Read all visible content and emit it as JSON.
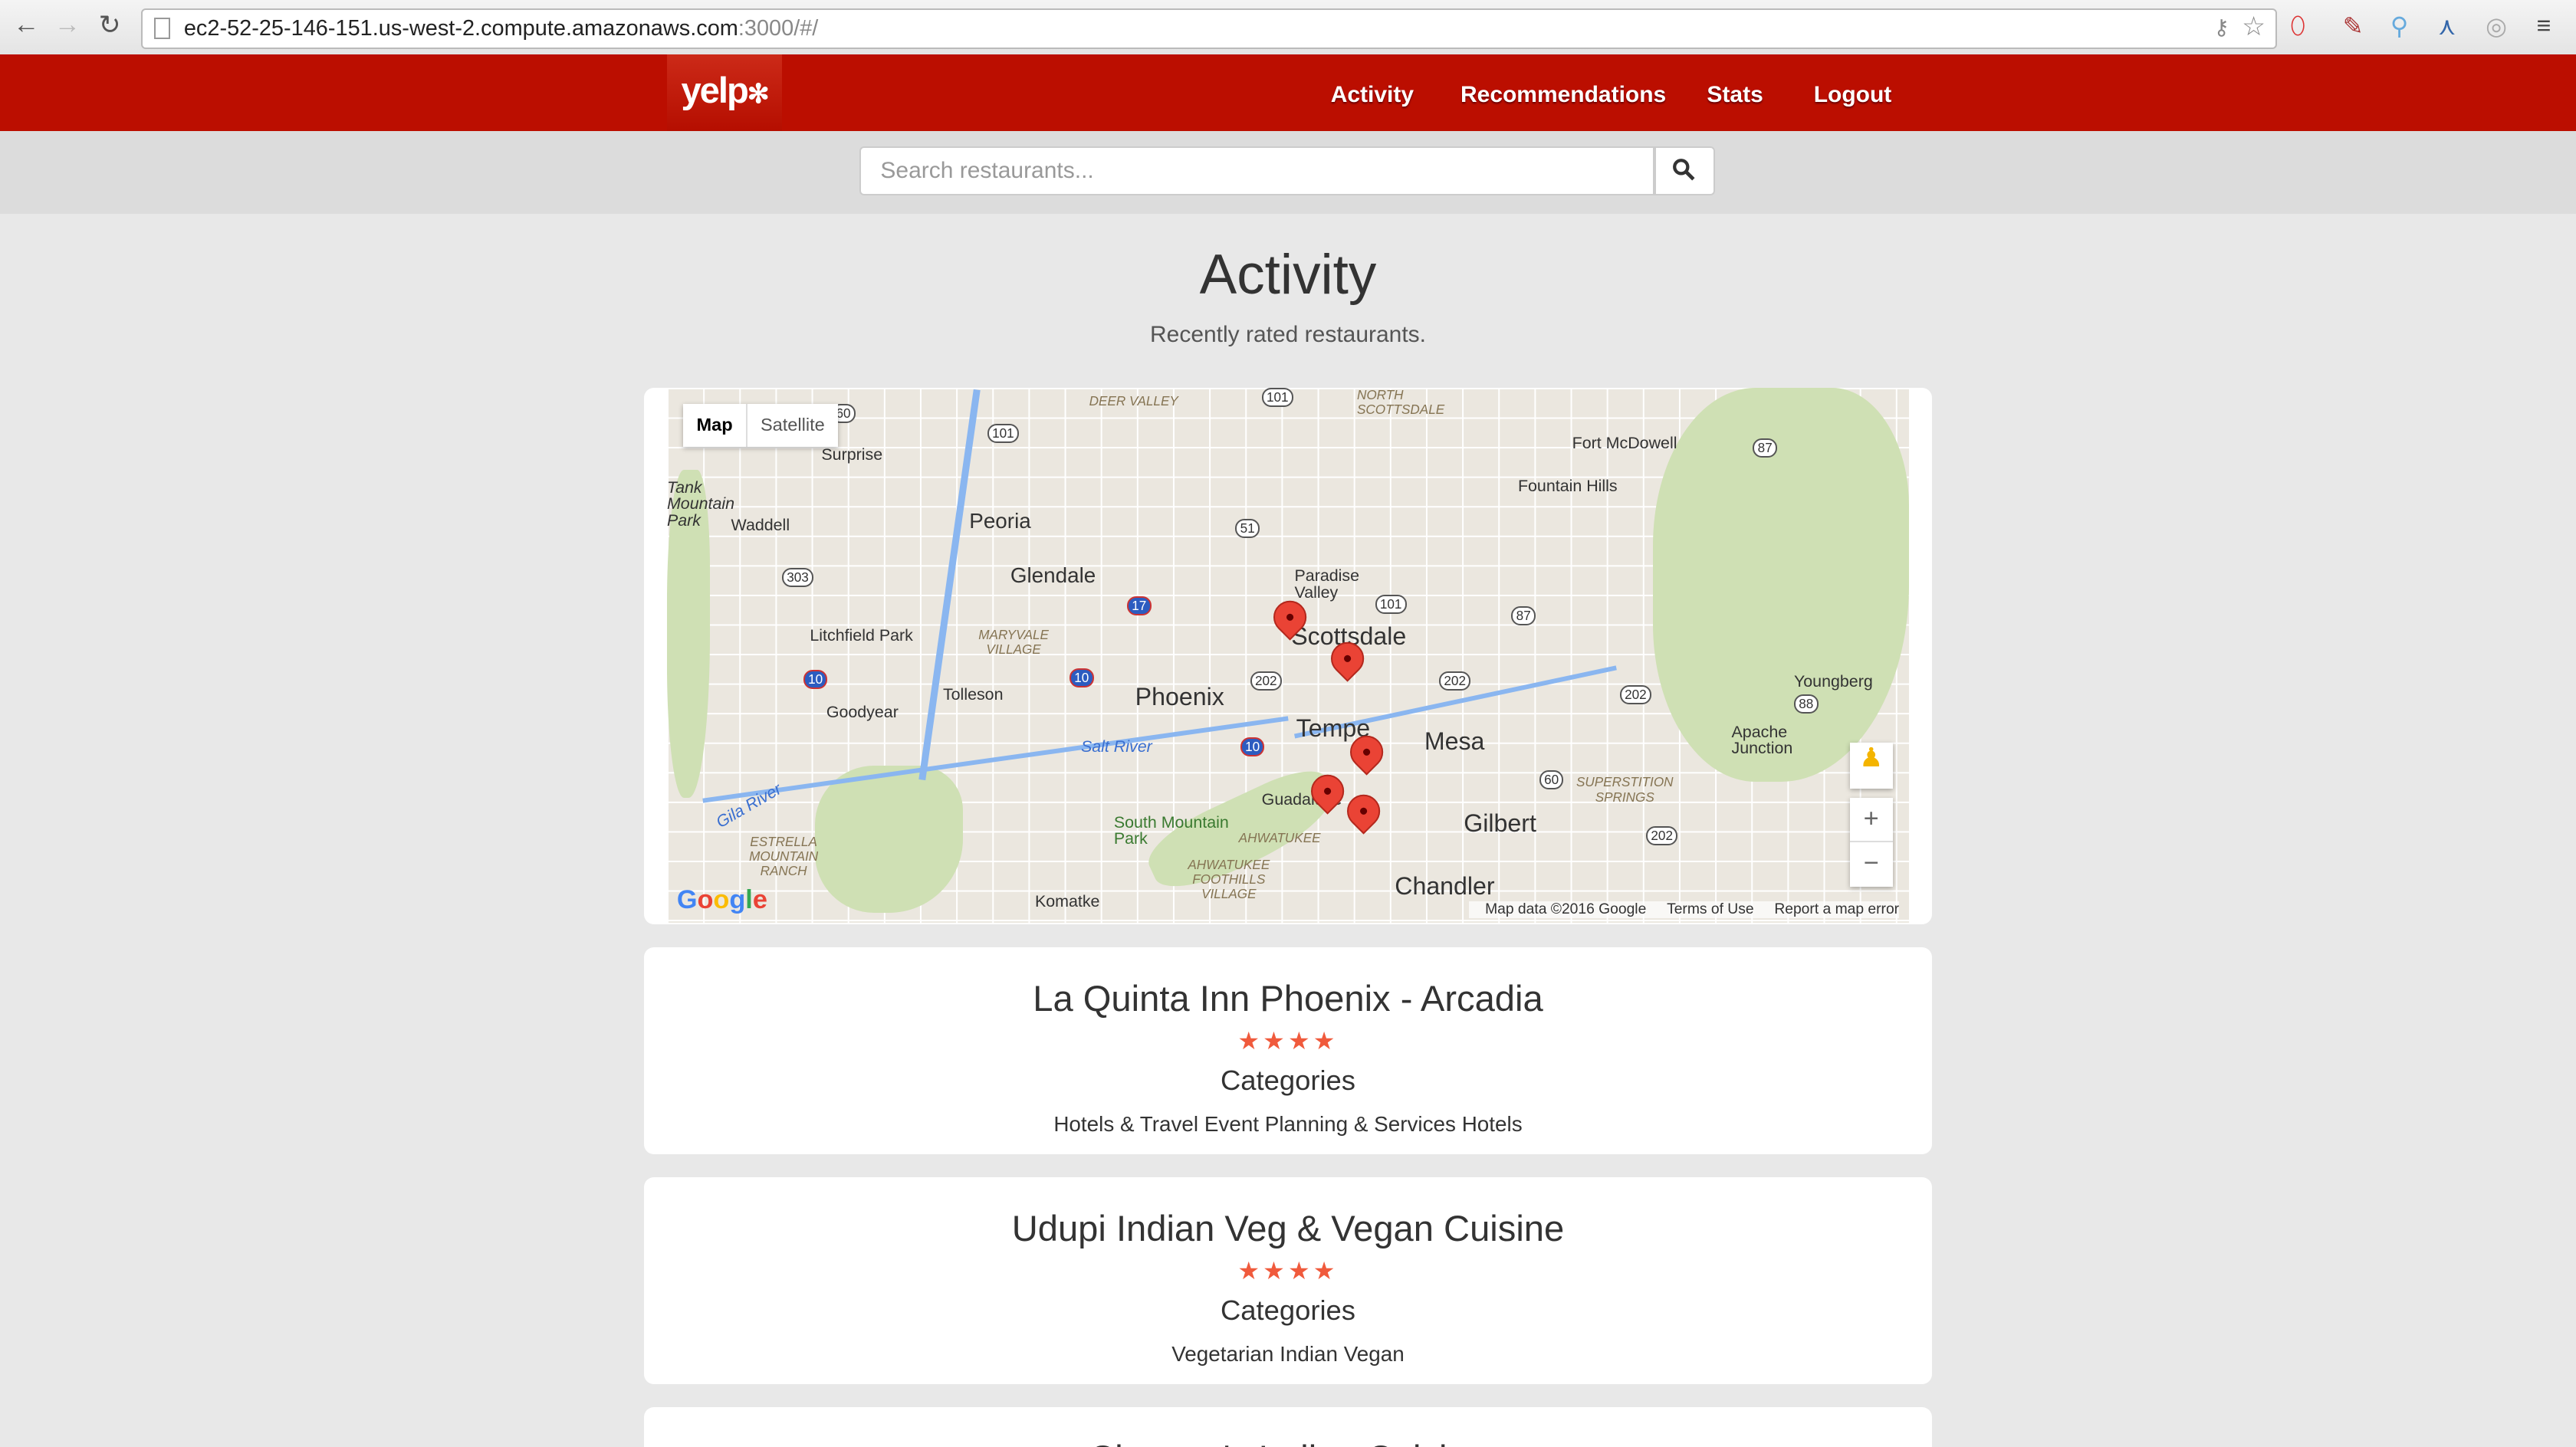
{
  "browser": {
    "url_host": "ec2-52-25-146-151.us-west-2.compute.amazonaws.com",
    "url_path": ":3000/#/"
  },
  "header": {
    "logo": "yelp",
    "nav": [
      "Activity",
      "Recommendations",
      "Stats",
      "Logout"
    ]
  },
  "search": {
    "placeholder": "Search restaurants..."
  },
  "page": {
    "title": "Activity",
    "subtitle": "Recently rated restaurants."
  },
  "map": {
    "type_buttons": [
      "Map",
      "Satellite"
    ],
    "cities": [
      "Surprise",
      "Peoria",
      "Glendale",
      "Waddell",
      "Litchfield Park",
      "Goodyear",
      "Tolleson",
      "Phoenix",
      "Scottsdale",
      "Tempe",
      "Mesa",
      "Gilbert",
      "Chandler",
      "Fort McDowell",
      "Fountain Hills",
      "Paradise Valley",
      "Youngberg",
      "Apache Junction",
      "Komatke",
      "Guadalupe",
      "South Mountain Park",
      "Salt River",
      "Gila River",
      "Tank Mountain Park"
    ],
    "districts": [
      "DEER VALLEY",
      "NORTH SCOTTSDALE",
      "MARYVALE VILLAGE",
      "AHWATUKEE",
      "AHWATUKEE FOOTHILLS VILLAGE",
      "ESTRELLA MOUNTAIN RANCH",
      "SUPERSTITION SPRINGS"
    ],
    "highways": [
      "60",
      "101",
      "101",
      "51",
      "303",
      "17",
      "10",
      "10",
      "10",
      "202",
      "202",
      "202",
      "202",
      "101",
      "87",
      "87",
      "88",
      "60"
    ],
    "google_logo": "Google",
    "attribution": [
      "Map data ©2016 Google",
      "Terms of Use",
      "Report a map error"
    ],
    "zoom_in": "+",
    "zoom_out": "−",
    "marker_count": 5
  },
  "restaurants": [
    {
      "name": "La Quinta Inn Phoenix - Arcadia",
      "stars": "★★★★",
      "rating": 4,
      "categories_label": "Categories",
      "categories": "Hotels & Travel Event Planning & Services Hotels"
    },
    {
      "name": "Udupi Indian Veg & Vegan Cuisine",
      "stars": "★★★★",
      "rating": 4,
      "categories_label": "Categories",
      "categories": "Vegetarian Indian Vegan"
    },
    {
      "name": "Chutney's Indian Cuisine"
    }
  ]
}
